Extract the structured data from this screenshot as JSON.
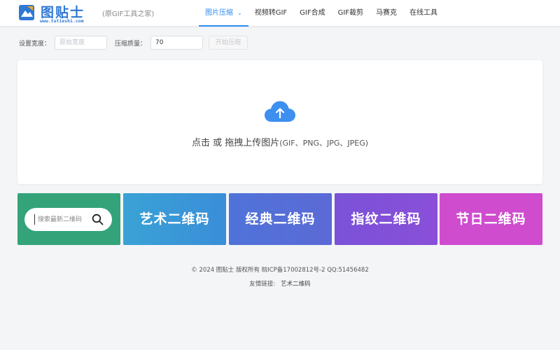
{
  "header": {
    "logo_text": "图贴士",
    "logo_url": "www.tutieshi.com",
    "subtitle": "(原GIF工具之家)",
    "nav": [
      {
        "label": "图片压缩",
        "active": true
      },
      {
        "label": "视频转GIF"
      },
      {
        "label": "GIF合成"
      },
      {
        "label": "GIF裁剪"
      },
      {
        "label": "马赛克"
      },
      {
        "label": "在线工具"
      }
    ],
    "nav_dropdown_icon": "chevron-down-icon"
  },
  "toolbar": {
    "width_label": "设置宽度：",
    "width_placeholder": "原始宽度",
    "width_value": "",
    "quality_label": "压缩质量：",
    "quality_value": "70",
    "start_button": "开始压缩"
  },
  "upload": {
    "icon": "cloud-upload-icon",
    "text_main": "点击 或 拖拽上传图片",
    "text_formats": "(GIF、PNG、JPG、JPEG)"
  },
  "cards": {
    "search_placeholder": "搜索最新二维码",
    "search_icon": "search-icon",
    "items": [
      {
        "label": "艺术二维码"
      },
      {
        "label": "经典二维码"
      },
      {
        "label": "指纹二维码"
      },
      {
        "label": "节日二维码"
      }
    ]
  },
  "footer": {
    "copyright": "© 2024 图贴士 版权所有 皖ICP备17002812号-2 QQ:51456482",
    "links_label": "友情链接:",
    "links": [
      {
        "label": "艺术二维码"
      }
    ]
  },
  "colors": {
    "accent": "#2d8cf0",
    "logo": "#2f78d4",
    "card_search": "#34a37a",
    "card_art": "#3a9ad6",
    "card_classic": "#5570d8",
    "card_fingerprint": "#8350d8",
    "card_holiday": "#cf4ccf"
  }
}
